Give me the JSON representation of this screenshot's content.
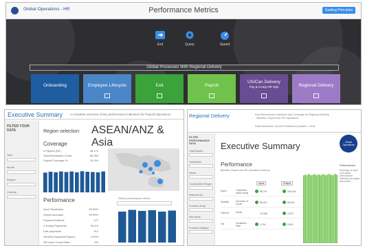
{
  "top": {
    "org": "Global Operations - HR",
    "title": "Performance Metrics",
    "guide_button": "Guiding Principles",
    "icons": [
      {
        "label": "Exit",
        "icon": "exit-icon"
      },
      {
        "label": "Query",
        "icon": "gear-icon"
      },
      {
        "label": "Speed",
        "icon": "gauge-icon"
      }
    ],
    "global_processes": "Global Processes With Regional Delivery",
    "tiles": [
      {
        "label": "Onboarding",
        "color": "#1e5ea0",
        "sub": ""
      },
      {
        "label": "Employee Lifecycle",
        "color": "#4a86c8",
        "sub": ""
      },
      {
        "label": "Exit",
        "color": "#3aa33a",
        "sub": ""
      },
      {
        "label": "Payroll",
        "color": "#6fc24c",
        "sub": ""
      },
      {
        "label": "US/Can Delivery",
        "color": "#6a4c93",
        "sub": "Pay & Comp   HR Ops"
      },
      {
        "label": "Regional Delivery",
        "color": "#9c7bc6",
        "sub": ""
      }
    ]
  },
  "left": {
    "title": "Executive Summary",
    "subtitle": "A complete overview of key performance indicators for Payroll Operations",
    "filter_title": "FILTER YOUR DATA",
    "filter_labels": [
      "Year",
      "Month",
      "Region",
      "Country"
    ],
    "region_selection": "Region selection:",
    "region": "ASEAN/ANZ & Asia",
    "coverage": "Coverage",
    "coverage_rows": [
      {
        "k": "# Payees (EE)",
        "v": "46,174"
      },
      {
        "k": "Total Employees Count",
        "v": "56,354"
      },
      {
        "k": "Payroll Coverage %",
        "v": "81.9%"
      }
    ],
    "performance": "Performance",
    "perf_rows": [
      {
        "k": "Input Timeliness",
        "v": "99.99%"
      },
      {
        "k": "Output accuracy",
        "v": "99.99%"
      },
      {
        "k": "Payment Defects",
        "v": "127"
      },
      {
        "k": "# Timely Payments",
        "v": "99.4%"
      },
      {
        "k": "Late payments",
        "v": "312"
      },
      {
        "k": "Severity Impacted Payees",
        "v": "0.00%"
      },
      {
        "k": "Off Cycle Count Ratio",
        "v": "0%"
      }
    ],
    "select_metric": "Select performance metric"
  },
  "right": {
    "title": "Regional Delivery",
    "subtitle": "Key Performance Indicators and Coverage for Regional Delivery - Benefits, Payroll and HR Operations",
    "subtitle2": "Data Refreshed: 4/1/2019 Reflected Quarter 1 2019",
    "filter_title": "FILTER PERFORMANCE DATA",
    "filter_labels": [
      "Year/Quarter",
      "Year/Month",
      "Month",
      "Country/Area Region",
      "Delivered by",
      "Provider Group",
      "Site Name",
      "Process Category"
    ],
    "exec": "Executive Summary",
    "perf": "Performance",
    "perf_sub": "Benefits, Payroll and HR Operations Delivery",
    "pills": [
      "Input",
      "Output"
    ],
    "rows": [
      {
        "a": "Input",
        "b": "Timeliness (data ready)",
        "n1": "98.7%",
        "n2": "100.0%"
      },
      {
        "a": "Quality",
        "b": "Accuracy of Inputs",
        "n1": "96.4%",
        "n2": "99.0%"
      },
      {
        "a": "Volume",
        "b": "Inputs",
        "n1": "12,345",
        "n2": "4,321"
      },
      {
        "a": "Ind.",
        "b": "Escalation Rate",
        "n1": "1.2%",
        "n2": "0.8%"
      }
    ],
    "logo_text": "Global Operations",
    "right_title": "Performance",
    "right_text": "Summary of input and output performance indicators by region and month."
  },
  "chart_data": [
    {
      "type": "bar",
      "title": "",
      "categories": [
        "",
        "",
        "",
        "",
        "",
        "",
        "",
        "",
        "",
        "",
        "",
        ""
      ],
      "values": [
        0.72,
        0.75,
        0.73,
        0.76,
        0.74,
        0.76,
        0.73,
        0.77,
        0.75,
        0.74,
        0.73,
        0.76
      ],
      "color": "#1f5a96"
    },
    {
      "type": "bar",
      "title": "",
      "categories": [
        "",
        "",
        "",
        "",
        "",
        ""
      ],
      "values": [
        0.9,
        0.95,
        0.92,
        0.94,
        0.9,
        0.93
      ],
      "color": "#1f5a96"
    },
    {
      "type": "bar",
      "title": "",
      "categories": [
        "",
        "",
        "",
        "",
        "",
        "",
        "",
        "",
        "",
        "",
        "",
        "",
        "",
        "",
        "",
        "",
        "",
        "",
        "",
        "",
        "",
        ""
      ],
      "values": [
        0.95,
        0.96,
        0.95,
        0.97,
        0.96,
        0.95,
        0.96,
        0.97,
        0.95,
        0.96,
        0.96,
        0.95,
        0.97,
        0.96,
        0.95,
        0.96,
        0.97,
        0.96,
        0.95,
        0.96,
        0.97,
        0.96
      ],
      "color": "#6cc24a"
    }
  ]
}
